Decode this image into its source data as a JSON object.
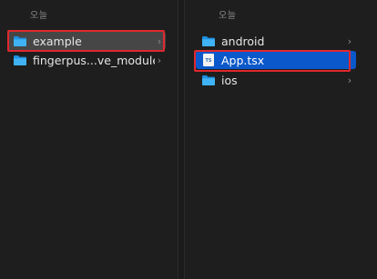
{
  "columns": [
    {
      "section_header": "오늘",
      "items": [
        {
          "name": "example",
          "type": "folder",
          "has_children": true,
          "selected": true
        },
        {
          "name": "fingerpus...ve_module",
          "type": "folder",
          "has_children": true,
          "selected": false
        }
      ]
    },
    {
      "section_header": "오늘",
      "items": [
        {
          "name": "android",
          "type": "folder",
          "has_children": true,
          "selected": false
        },
        {
          "name": "App.tsx",
          "type": "file",
          "badge": "TS",
          "has_children": false,
          "selected": true
        },
        {
          "name": "ios",
          "type": "folder",
          "has_children": true,
          "selected": false
        }
      ]
    }
  ],
  "chevron_glyph": "›",
  "colors": {
    "background": "#1e1e1e",
    "folder": "#1da1f2",
    "selection_gray": "#464646",
    "selection_blue": "#0a58ca",
    "highlight_border": "#e0282e"
  }
}
